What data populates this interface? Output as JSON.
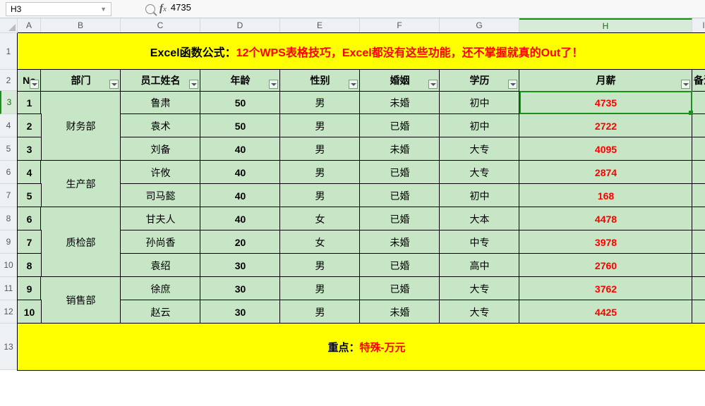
{
  "formula_bar": {
    "cell_ref": "H3",
    "value": "4735"
  },
  "col_headers": [
    "A",
    "B",
    "C",
    "D",
    "E",
    "F",
    "G",
    "H",
    "I"
  ],
  "row_headers": [
    "1",
    "2",
    "3",
    "4",
    "5",
    "6",
    "7",
    "8",
    "9",
    "10",
    "11",
    "12",
    "13"
  ],
  "selected_col": "H",
  "selected_row": "3",
  "title": {
    "part1": "Excel函数公式：",
    "part2": "12个WPS表格技巧，Excel都没有这些功能，还不掌握就真的Out了！"
  },
  "headers": {
    "no": "No",
    "dept": "部门",
    "name": "员工姓名",
    "age": "年龄",
    "gender": "性别",
    "marriage": "婚姻",
    "edu": "学历",
    "salary": "月薪",
    "remark": "备注"
  },
  "dept_groups": [
    {
      "name": "财务部",
      "rows": 3
    },
    {
      "name": "生产部",
      "rows": 2
    },
    {
      "name": "质检部",
      "rows": 3
    },
    {
      "name": "销售部",
      "rows": 2
    }
  ],
  "rows": [
    {
      "no": "1",
      "name": "鲁肃",
      "age": "50",
      "gender": "男",
      "marriage": "未婚",
      "edu": "初中",
      "salary": "4735"
    },
    {
      "no": "2",
      "name": "袁术",
      "age": "50",
      "gender": "男",
      "marriage": "已婚",
      "edu": "初中",
      "salary": "2722"
    },
    {
      "no": "3",
      "name": "刘备",
      "age": "40",
      "gender": "男",
      "marriage": "未婚",
      "edu": "大专",
      "salary": "4095"
    },
    {
      "no": "4",
      "name": "许攸",
      "age": "40",
      "gender": "男",
      "marriage": "已婚",
      "edu": "大专",
      "salary": "2874"
    },
    {
      "no": "5",
      "name": "司马懿",
      "age": "40",
      "gender": "男",
      "marriage": "已婚",
      "edu": "初中",
      "salary": "168"
    },
    {
      "no": "6",
      "name": "甘夫人",
      "age": "40",
      "gender": "女",
      "marriage": "已婚",
      "edu": "大本",
      "salary": "4478"
    },
    {
      "no": "7",
      "name": "孙尚香",
      "age": "20",
      "gender": "女",
      "marriage": "未婚",
      "edu": "中专",
      "salary": "3978"
    },
    {
      "no": "8",
      "name": "袁绍",
      "age": "30",
      "gender": "男",
      "marriage": "已婚",
      "edu": "高中",
      "salary": "2760"
    },
    {
      "no": "9",
      "name": "徐庶",
      "age": "30",
      "gender": "男",
      "marriage": "已婚",
      "edu": "大专",
      "salary": "3762"
    },
    {
      "no": "10",
      "name": "赵云",
      "age": "30",
      "gender": "男",
      "marriage": "未婚",
      "edu": "大专",
      "salary": "4425"
    }
  ],
  "footer": {
    "part1": "重点：",
    "part2": "特殊-万元"
  },
  "active_cell": {
    "col": "H",
    "row": "3"
  }
}
